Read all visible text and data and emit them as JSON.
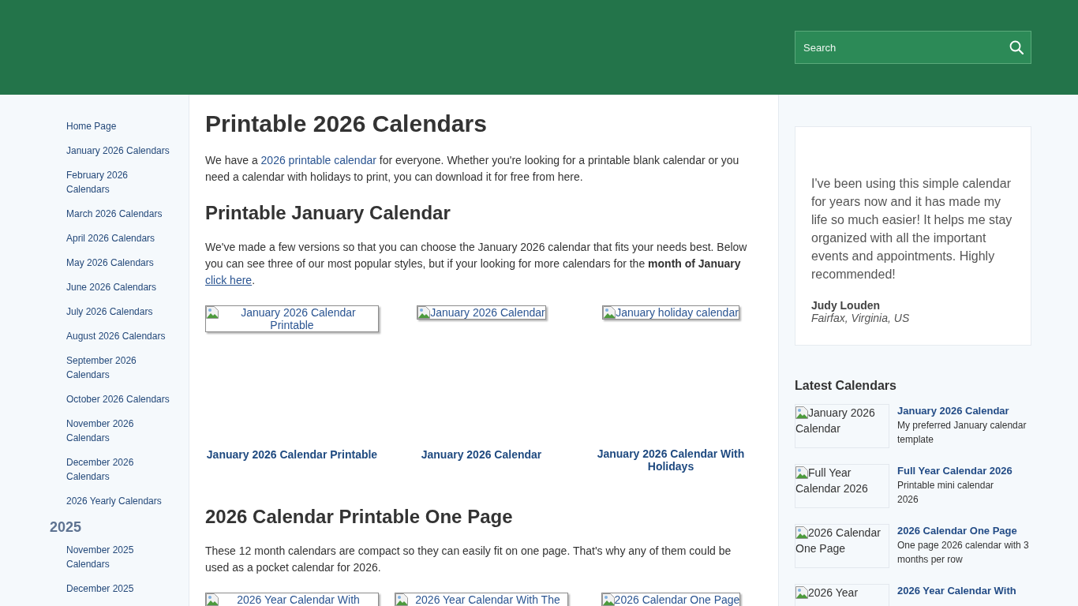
{
  "header": {
    "search": {
      "placeholder": "Search"
    }
  },
  "sidebar": {
    "items": [
      "Home Page",
      "January 2026 Calendars",
      "February 2026 Calendars",
      "March 2026 Calendars",
      "April 2026 Calendars",
      "May 2026 Calendars",
      "June 2026 Calendars",
      "July 2026 Calendars",
      "August 2026 Calendars",
      "September 2026 Calendars",
      "October 2026 Calendars",
      "November 2026 Calendars",
      "December 2026 Calendars",
      "2026 Yearly Calendars"
    ],
    "sections": [
      {
        "heading": "2025",
        "items": [
          "November 2025 Calendars",
          "December 2025"
        ]
      }
    ]
  },
  "main": {
    "title": "Printable 2026 Calendars",
    "intro": [
      {
        "kind": "text",
        "text": "We have a "
      },
      {
        "kind": "link",
        "text": "2026 printable calendar",
        "underlined": false
      },
      {
        "kind": "text",
        "text": " for everyone. Whether you're looking for a printable blank calendar or you need a calendar with holidays to print, you can download it for free from here."
      }
    ],
    "sections": [
      {
        "heading": "Printable January Calendar",
        "paragraph": [
          {
            "kind": "text",
            "text": "We've made a few versions so that you can choose the January 2026 calendar that fits your needs best. Below you can see three of our most popular styles, but if your looking for more calendars for the **month of January** "
          },
          {
            "kind": "link",
            "text": "click here",
            "underlined": true
          },
          {
            "kind": "text",
            "text": "."
          }
        ],
        "images": [
          {
            "kind": "framed",
            "alt": "January 2026 Calendar Printable",
            "caption": "January 2026 Calendar Printable"
          },
          {
            "kind": "inline",
            "alt": "January 2026 Calendar",
            "caption": "January 2026 Calendar"
          },
          {
            "kind": "inline",
            "alt": "January holiday calendar",
            "caption": "January 2026 Calendar With Holidays"
          }
        ]
      },
      {
        "heading": "2026 Calendar Printable One Page",
        "paragraph": [
          {
            "kind": "text",
            "text": "These 12 month calendars are compact so they can easily fit on one page. That's why any of them could be used as a pocket calendar for 2026."
          }
        ],
        "images": [
          {
            "kind": "framed",
            "alt": "2026 Year Calendar With"
          },
          {
            "kind": "framed",
            "alt": "2026 Year Calendar With The"
          },
          {
            "kind": "inline",
            "alt": "2026 Calendar One Page"
          }
        ]
      }
    ]
  },
  "aside": {
    "testimonial": {
      "quote": "I've been using this simple calendar for years now and it has made my life so much easier! It helps me stay organized with all the important events and appointments. Highly recommended!",
      "author": "Judy Louden",
      "location": "Fairfax, Virginia, US"
    },
    "latest": {
      "heading": "Latest Calendars",
      "items": [
        {
          "alt": "January 2026 Calendar",
          "title": "January 2026 Calendar",
          "description": "My preferred January calendar template"
        },
        {
          "alt": "Full Year Calendar 2026",
          "title": "Full Year Calendar 2026",
          "description": "Printable mini calendar\n2026"
        },
        {
          "alt": "2026 Calendar One Page",
          "title": "2026 Calendar One Page",
          "description": "One page 2026 calendar with 3 months per row"
        },
        {
          "alt": "2026 Year",
          "title": "2026 Year Calendar With"
        }
      ]
    }
  }
}
